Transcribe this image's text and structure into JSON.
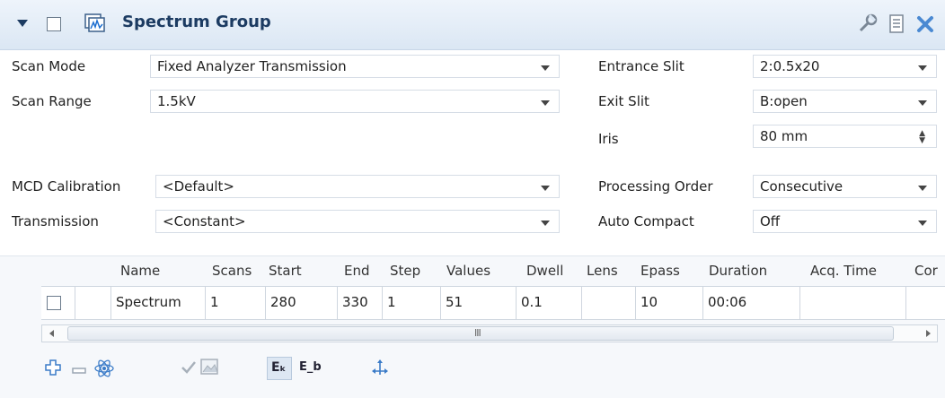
{
  "header": {
    "title": "Spectrum Group"
  },
  "form": {
    "scan_mode": {
      "label": "Scan Mode",
      "value": "Fixed Analyzer Transmission"
    },
    "scan_range": {
      "label": "Scan Range",
      "value": "1.5kV"
    },
    "mcd_calibration": {
      "label": "MCD Calibration",
      "value": "<Default>"
    },
    "transmission": {
      "label": "Transmission",
      "value": "<Constant>"
    },
    "entrance_slit": {
      "label": "Entrance Slit",
      "value": "2:0.5x20"
    },
    "exit_slit": {
      "label": "Exit Slit",
      "value": "B:open"
    },
    "iris": {
      "label": "Iris",
      "value": "80 mm"
    },
    "processing_order": {
      "label": "Processing Order",
      "value": "Consecutive"
    },
    "auto_compact": {
      "label": "Auto Compact",
      "value": "Off"
    }
  },
  "table": {
    "columns": [
      "Name",
      "Scans",
      "Start",
      "End",
      "Step",
      "Values",
      "Dwell",
      "Lens",
      "Epass",
      "Duration",
      "Acq. Time",
      "Cor"
    ],
    "rows": [
      {
        "name": "Spectrum",
        "scans": "1",
        "start": "280",
        "end": "330",
        "step": "1",
        "values": "51",
        "dwell": "0.1",
        "lens": "",
        "epass": "10",
        "duration": "00:06",
        "acq_time": ""
      }
    ]
  },
  "scrollbar": {
    "grip": "III"
  },
  "toolbar": {
    "ek_label": "Eₖ",
    "eb_label": "E_b"
  },
  "colors": {
    "accent": "#3a7bc8",
    "header_bg": "#dbe7f4",
    "title": "#1c3b62"
  }
}
